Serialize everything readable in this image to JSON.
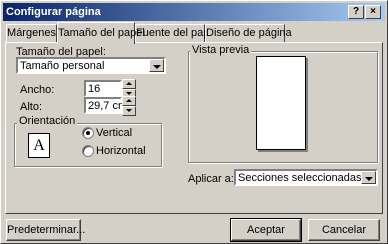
{
  "window": {
    "title": "Configurar página",
    "help_label": "?",
    "close_label": "×"
  },
  "tabs": [
    {
      "label": "Márgenes"
    },
    {
      "label": "Tamaño del papel"
    },
    {
      "label": "Fuente del papel"
    },
    {
      "label": "Diseño de página"
    }
  ],
  "paper": {
    "size_label": "Tamaño del papel:",
    "size_value": "Tamaño personal",
    "width_label": "Ancho:",
    "width_value": "16",
    "height_label": "Alto:",
    "height_value": "29,7 cm"
  },
  "orientation": {
    "group_label": "Orientación",
    "icon_glyph": "A",
    "vertical_label": "Vertical",
    "horizontal_label": "Horizontal",
    "selected": "Vertical"
  },
  "preview": {
    "label": "Vista previa"
  },
  "apply": {
    "label": "Aplicar a:",
    "value": "Secciones seleccionadas"
  },
  "buttons": {
    "default_label": "Predeterminar...",
    "ok_label": "Aceptar",
    "cancel_label": "Cancelar"
  },
  "icons": {
    "portrait": "portrait-page-icon"
  }
}
